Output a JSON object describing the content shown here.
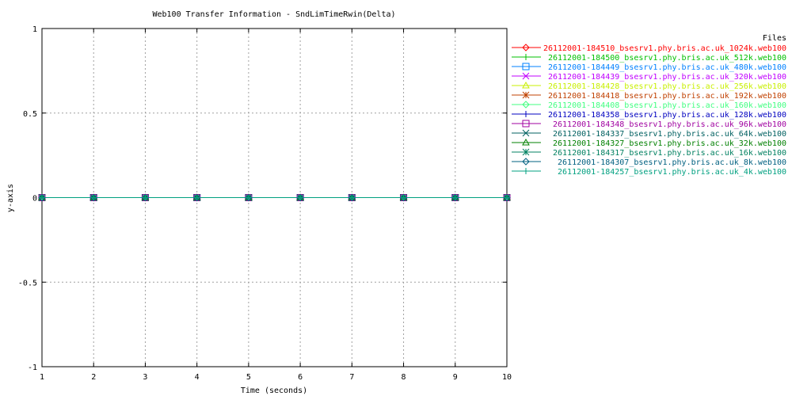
{
  "chart_data": {
    "type": "line",
    "title": "Web100 Transfer Information - SndLimTimeRwin(Delta)",
    "xlabel": "Time (seconds)",
    "ylabel": "y-axis",
    "xlim": [
      1,
      10
    ],
    "ylim": [
      -1,
      1
    ],
    "xticks": [
      1,
      2,
      3,
      4,
      5,
      6,
      7,
      8,
      9,
      10
    ],
    "yticks": [
      -1,
      -0.5,
      0,
      0.5,
      1
    ],
    "xtick_labels": [
      "1",
      "2",
      "3",
      "4",
      "5",
      "6",
      "7",
      "8",
      "9",
      "10"
    ],
    "ytick_labels": [
      "-1",
      "-0.5",
      "0",
      "0.5",
      "1"
    ],
    "grid": true,
    "legend_title": "Files",
    "legend_position": "right",
    "series": [
      {
        "name": "26112001-184510_bsesrv1.phy.bris.ac.uk_1024k.web100",
        "color": "#ff0000",
        "marker": "diamond",
        "x": [
          1,
          2,
          3,
          4,
          5,
          6,
          7,
          8,
          9,
          10
        ],
        "y": [
          0,
          0,
          0,
          0,
          0,
          0,
          0,
          0,
          0,
          0
        ]
      },
      {
        "name": "26112001-184500_bsesrv1.phy.bris.ac.uk_512k.web100",
        "color": "#00c000",
        "marker": "plus",
        "x": [
          1,
          2,
          3,
          4,
          5,
          6,
          7,
          8,
          9,
          10
        ],
        "y": [
          0,
          0,
          0,
          0,
          0,
          0,
          0,
          0,
          0,
          0
        ]
      },
      {
        "name": "26112001-184449_bsesrv1.phy.bris.ac.uk_480k.web100",
        "color": "#0080ff",
        "marker": "square",
        "x": [
          1,
          2,
          3,
          4,
          5,
          6,
          7,
          8,
          9,
          10
        ],
        "y": [
          0,
          0,
          0,
          0,
          0,
          0,
          0,
          0,
          0,
          0
        ]
      },
      {
        "name": "26112001-184439_bsesrv1.phy.bris.ac.uk_320k.web100",
        "color": "#c000ff",
        "marker": "cross",
        "x": [
          1,
          2,
          3,
          4,
          5,
          6,
          7,
          8,
          9,
          10
        ],
        "y": [
          0,
          0,
          0,
          0,
          0,
          0,
          0,
          0,
          0,
          0
        ]
      },
      {
        "name": "26112001-184428_bsesrv1.phy.bris.ac.uk_256k.web100",
        "color": "#c8f000",
        "marker": "triangle",
        "x": [
          1,
          2,
          3,
          4,
          5,
          6,
          7,
          8,
          9,
          10
        ],
        "y": [
          0,
          0,
          0,
          0,
          0,
          0,
          0,
          0,
          0,
          0
        ]
      },
      {
        "name": "26112001-184418_bsesrv1.phy.bris.ac.uk_192k.web100",
        "color": "#c04000",
        "marker": "star",
        "x": [
          1,
          2,
          3,
          4,
          5,
          6,
          7,
          8,
          9,
          10
        ],
        "y": [
          0,
          0,
          0,
          0,
          0,
          0,
          0,
          0,
          0,
          0
        ]
      },
      {
        "name": "26112001-184408_bsesrv1.phy.bris.ac.uk_160k.web100",
        "color": "#40ff80",
        "marker": "diamond",
        "x": [
          1,
          2,
          3,
          4,
          5,
          6,
          7,
          8,
          9,
          10
        ],
        "y": [
          0,
          0,
          0,
          0,
          0,
          0,
          0,
          0,
          0,
          0
        ]
      },
      {
        "name": "26112001-184358_bsesrv1.phy.bris.ac.uk_128k.web100",
        "color": "#0000c0",
        "marker": "plus",
        "x": [
          1,
          2,
          3,
          4,
          5,
          6,
          7,
          8,
          9,
          10
        ],
        "y": [
          0,
          0,
          0,
          0,
          0,
          0,
          0,
          0,
          0,
          0
        ]
      },
      {
        "name": "26112001-184348_bsesrv1.phy.bris.ac.uk_96k.web100",
        "color": "#a000a0",
        "marker": "square",
        "x": [
          1,
          2,
          3,
          4,
          5,
          6,
          7,
          8,
          9,
          10
        ],
        "y": [
          0,
          0,
          0,
          0,
          0,
          0,
          0,
          0,
          0,
          0
        ]
      },
      {
        "name": "26112001-184337_bsesrv1.phy.bris.ac.uk_64k.web100",
        "color": "#006060",
        "marker": "cross",
        "x": [
          1,
          2,
          3,
          4,
          5,
          6,
          7,
          8,
          9,
          10
        ],
        "y": [
          0,
          0,
          0,
          0,
          0,
          0,
          0,
          0,
          0,
          0
        ]
      },
      {
        "name": "26112001-184327_bsesrv1.phy.bris.ac.uk_32k.web100",
        "color": "#008000",
        "marker": "triangle",
        "x": [
          1,
          2,
          3,
          4,
          5,
          6,
          7,
          8,
          9,
          10
        ],
        "y": [
          0,
          0,
          0,
          0,
          0,
          0,
          0,
          0,
          0,
          0
        ]
      },
      {
        "name": "26112001-184317_bsesrv1.phy.bris.ac.uk_16k.web100",
        "color": "#008060",
        "marker": "star",
        "x": [
          1,
          2,
          3,
          4,
          5,
          6,
          7,
          8,
          9,
          10
        ],
        "y": [
          0,
          0,
          0,
          0,
          0,
          0,
          0,
          0,
          0,
          0
        ]
      },
      {
        "name": "26112001-184307_bsesrv1.phy.bris.ac.uk_8k.web100",
        "color": "#006080",
        "marker": "diamond",
        "x": [
          1,
          2,
          3,
          4,
          5,
          6,
          7,
          8,
          9,
          10
        ],
        "y": [
          0,
          0,
          0,
          0,
          0,
          0,
          0,
          0,
          0,
          0
        ]
      },
      {
        "name": "26112001-184257_bsesrv1.phy.bris.ac.uk_4k.web100",
        "color": "#00a080",
        "marker": "plus",
        "x": [
          1,
          2,
          3,
          4,
          5,
          6,
          7,
          8,
          9,
          10
        ],
        "y": [
          0,
          0,
          0,
          0,
          0,
          0,
          0,
          0,
          0,
          0
        ]
      }
    ]
  }
}
